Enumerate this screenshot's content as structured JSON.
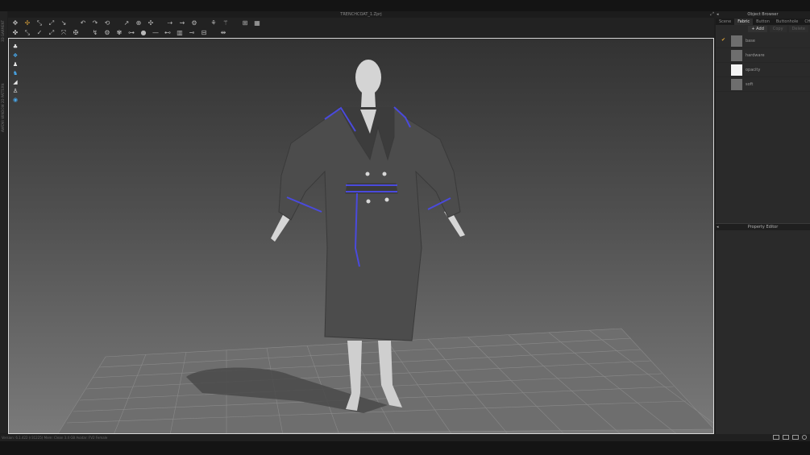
{
  "window": {
    "title": "TRENCHCOAT_1.Zprj"
  },
  "left_strip": {
    "label_top": "3D GARMENT",
    "label_bottom": "AVATAR WINDOW  2D PATTERN"
  },
  "toolbar": {
    "row1": [
      "select-mesh-icon",
      "transform-icon",
      "move-icon",
      "rotate-icon",
      "scale-icon",
      "fold-icon",
      "arrange-icon",
      "tuck-icon",
      "pin-icon",
      "box-pin-icon",
      "steam-icon",
      "measure-icon",
      "tape-icon",
      "hanger-icon",
      "shirt-icon",
      "grid-icon",
      "layout-icon"
    ],
    "row2": [
      "avatar-icon",
      "pose-icon",
      "shape-icon",
      "segment-icon",
      "strap-icon",
      "internal-line-icon",
      "seam-icon",
      "fold-arrange-icon",
      "zip-icon",
      "button-icon",
      "topstitch-icon",
      "trim-icon",
      "belt-icon",
      "sew-icon",
      "piping-icon",
      "puckering-icon"
    ]
  },
  "viewport_tools": [
    "hanger-icon",
    "texture-icon",
    "avatar-icon",
    "shirt-blue-icon",
    "fabric-icon",
    "avatar-outline-icon",
    "sphere-icon"
  ],
  "object_browser": {
    "title": "Object Browser",
    "tabs": [
      "Scene",
      "Fabric",
      "Button",
      "Buttonhole",
      "CH"
    ],
    "active_tab": "Fabric",
    "add_label": "+ Add",
    "copy_label": "Copy",
    "delete_label": "Delete",
    "items": [
      {
        "name": "base",
        "checked": true,
        "swatch": "#6e6e6e"
      },
      {
        "name": "hardware",
        "checked": false,
        "swatch": "#707070"
      },
      {
        "name": "opacity",
        "checked": false,
        "swatch": "#f4f4f4"
      },
      {
        "name": "soft",
        "checked": false,
        "swatch": "#6a6a6a"
      }
    ]
  },
  "property_editor": {
    "title": "Property Editor"
  },
  "status": {
    "text": "Version: 6.1.422 (r31225)   Mem: Clean 3.4 GB   Avatar: FV2 Female"
  },
  "colors": {
    "accent": "#e0a63a",
    "seam": "#4a4adc",
    "viewport_border": "#d8d8d8"
  }
}
